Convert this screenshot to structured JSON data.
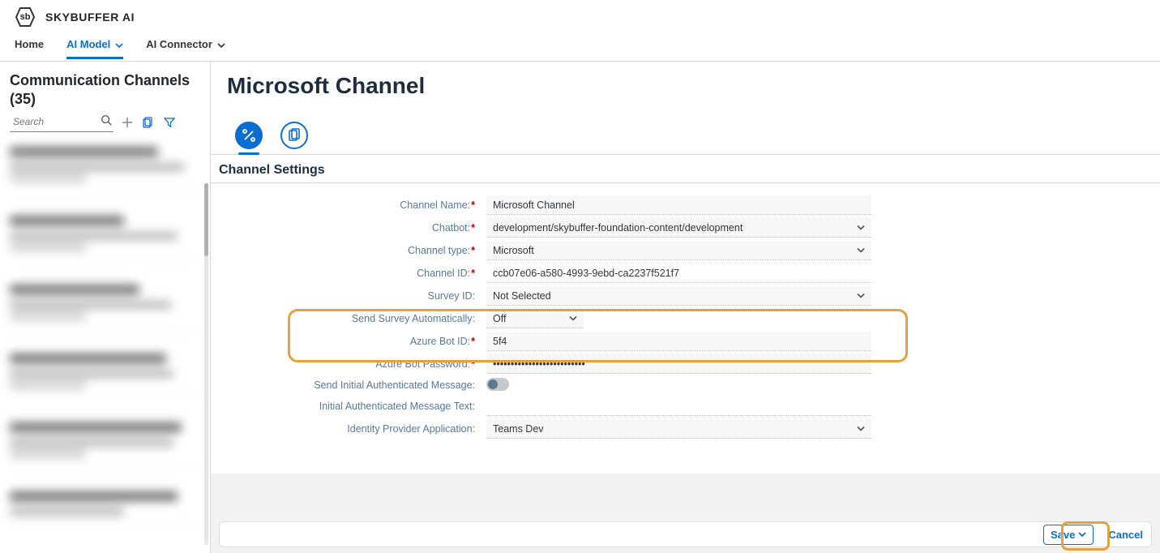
{
  "shell": {
    "logo_text": "sb",
    "app_title": "SKYBUFFER AI"
  },
  "nav": {
    "home": "Home",
    "ai_model": "AI Model",
    "ai_connector": "AI Connector"
  },
  "sidebar": {
    "title": "Communication Channels (35)",
    "search_placeholder": "Search"
  },
  "page": {
    "title": "Microsoft Channel",
    "section_title": "Channel Settings"
  },
  "form": {
    "labels": {
      "channel_name": "Channel Name:",
      "chatbot": "Chatbot:",
      "channel_type": "Channel type:",
      "channel_id": "Channel ID:",
      "survey_id": "Survey ID:",
      "send_survey": "Send Survey Automatically:",
      "azure_bot_id": "Azure Bot ID:",
      "azure_bot_password": "Azure Bot Password:",
      "send_initial_auth_msg": "Send Initial Authenticated Message:",
      "initial_auth_msg_text": "Initial Authenticated Message Text:",
      "idp_app": "Identity Provider Application:"
    },
    "values": {
      "channel_name": "Microsoft Channel",
      "chatbot": "development/skybuffer-foundation-content/development",
      "channel_type": "Microsoft",
      "channel_id": "ccb07e06-a580-4993-9ebd-ca2237f521f7",
      "survey_id": "Not Selected",
      "send_survey": "Off",
      "azure_bot_id": "5f4",
      "azure_bot_password": "••••••••••••••••••••••••••",
      "initial_auth_msg_text": "",
      "idp_app": "Teams Dev"
    }
  },
  "footer": {
    "save": "Save",
    "cancel": "Cancel"
  }
}
